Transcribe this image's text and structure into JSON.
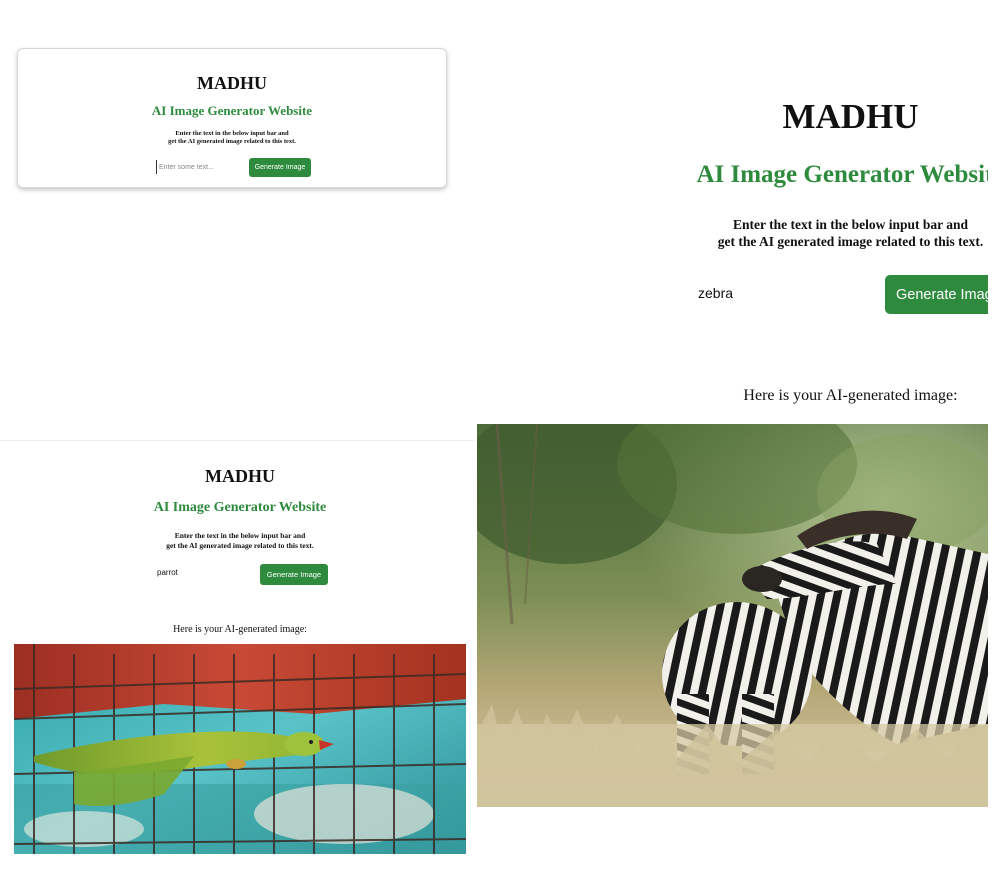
{
  "panels": [
    {
      "brand": "MADHU",
      "subtitle": "AI Image Generator Website",
      "description_line1": "Enter the text in the below input bar and",
      "description_line2": "get the AI generated image related to this text.",
      "input_value": "",
      "input_placeholder": "Enter some text...",
      "button_label": "Generate Image"
    },
    {
      "brand": "MADHU",
      "subtitle": "AI Image Generator Website",
      "description_line1": "Enter the text in the below input bar and",
      "description_line2": "get the AI generated image related to this text.",
      "input_value": "zebra",
      "button_label": "Generate Image",
      "result_label": "Here is your AI-generated image:",
      "image_subject": "zebra"
    },
    {
      "brand": "MADHU",
      "subtitle": "AI Image Generator Website",
      "description_line1": "Enter the text in the below input bar and",
      "description_line2": "get the AI generated image related to this text.",
      "input_value": "parrot",
      "button_label": "Generate Image",
      "result_label": "Here is your AI-generated image:",
      "image_subject": "parrot"
    }
  ],
  "colors": {
    "accent": "#2e8b3e",
    "button_text": "#ffffff"
  }
}
